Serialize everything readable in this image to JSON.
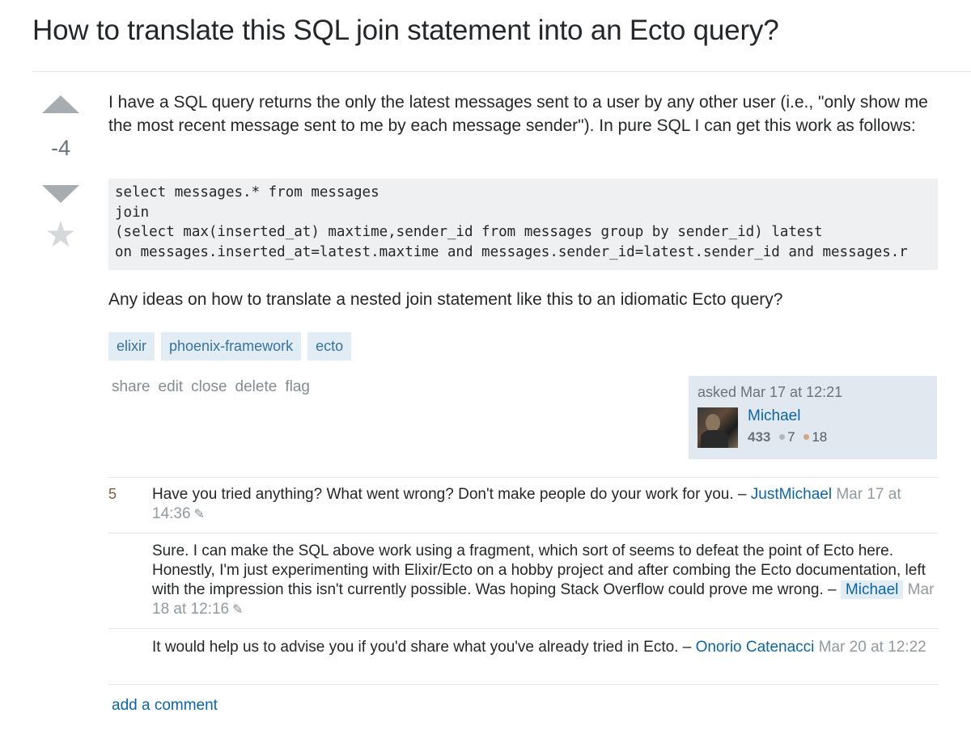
{
  "question": {
    "title": "How to translate this SQL join statement into an Ecto query?",
    "vote_count": "-4",
    "body_p1": "I have a SQL query returns the only the latest messages sent to a user by any other user (i.e., \"only show me the most recent message sent to me by each message sender\"). In pure SQL I can get this work as follows:",
    "code": "select messages.* from messages\njoin\n(select max(inserted_at) maxtime,sender_id from messages group by sender_id) latest\non messages.inserted_at=latest.maxtime and messages.sender_id=latest.sender_id and messages.r",
    "body_p2": "Any ideas on how to translate a nested join statement like this to an idiomatic Ecto query?",
    "tags": [
      "elixir",
      "phoenix-framework",
      "ecto"
    ],
    "menu": [
      "share",
      "edit",
      "close",
      "delete",
      "flag"
    ]
  },
  "owner": {
    "asked": "asked Mar 17 at 12:21",
    "name": "Michael",
    "rep": "433",
    "silver": "7",
    "bronze": "18"
  },
  "comments": [
    {
      "score": "5",
      "text": "Have you tried anything? What went wrong? Don't make people do your work for you. – ",
      "user": "JustMichael",
      "date": "Mar 17 at 14:36"
    },
    {
      "score": "",
      "text": "Sure. I can make the SQL above work using a fragment, which sort of seems to defeat the point of Ecto here. Honestly, I'm just experimenting with Elixir/Ecto on a hobby project and after combing the Ecto documentation, left with the impression this isn't currently possible. Was hoping Stack Overflow could prove me wrong. – ",
      "user": "Michael",
      "date": "Mar 18 at 12:16"
    },
    {
      "score": "",
      "text": "It would help us to advise you if you'd share what you've already tried in Ecto. – ",
      "user": "Onorio Catenacci",
      "date": "Mar 20 at 12:22"
    }
  ],
  "add_comment": "add a comment",
  "icons": {
    "upvote": "arrow-up-icon",
    "downvote": "arrow-down-icon",
    "favorite": "star-icon",
    "edit": "pencil-icon"
  },
  "colors": {
    "link": "#0c65a5",
    "tag_bg": "#e1ecf4",
    "tag_text": "#39739d",
    "owner_bg": "#e1e8ef",
    "code_bg": "#eff0f1"
  }
}
